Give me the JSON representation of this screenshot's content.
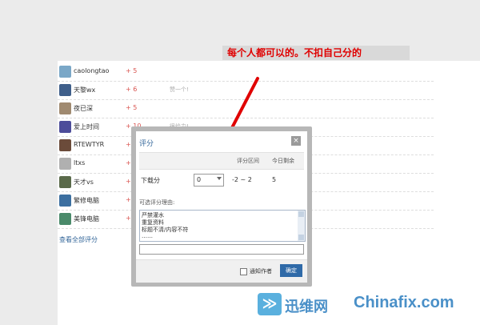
{
  "annotation": "每个人都可以的。不扣自己分的",
  "raters": [
    {
      "name": "caolongtao",
      "score": "+ 5",
      "note": "",
      "avatar_color": "#7aa7c7"
    },
    {
      "name": "天黎wx",
      "score": "+ 6",
      "note": "赞一个!",
      "avatar_color": "#3f5f8a"
    },
    {
      "name": "夜已深",
      "score": "+ 5",
      "note": "",
      "avatar_color": "#a08a70"
    },
    {
      "name": "爱上时间",
      "score": "+ 10",
      "note": "很给力!",
      "avatar_color": "#4d4d9a"
    },
    {
      "name": "RTEWTYR",
      "score": "+ 6",
      "note": "",
      "avatar_color": "#6b4b3a"
    },
    {
      "name": "ltxs",
      "score": "+ 6",
      "note": "",
      "avatar_color": "#b0b0b0"
    },
    {
      "name": "天才vs",
      "score": "+ 5",
      "note": "",
      "avatar_color": "#5a6a4a"
    },
    {
      "name": "繁修电脑",
      "score": "+ 5",
      "note": "",
      "avatar_color": "#3c6fa0"
    },
    {
      "name": "美锋电脑",
      "score": "+ 5",
      "note": "",
      "avatar_color": "#4a8a6a"
    }
  ],
  "view_all": "查看全部评分",
  "dialog": {
    "title": "评分",
    "close": "×",
    "col_range": "评分区间",
    "col_remaining": "今日剩余",
    "row_label": "下载分",
    "score_value": "0",
    "range": "-2 ~ 2",
    "remaining": "5",
    "reason_label": "可选评分理由:",
    "reasons": [
      "严禁灌水",
      "重复资料",
      "标题不清/内容不符",
      "……"
    ],
    "notify_label": "通知作者",
    "confirm": "确定"
  },
  "watermark": {
    "icon": "≫",
    "cn": "迅维网",
    "en": "Chinafix.com"
  },
  "colors": {
    "accent": "#2f6aa8",
    "annotation_text": "#e00000",
    "score": "#d9534f",
    "arrow": "#e00000"
  }
}
